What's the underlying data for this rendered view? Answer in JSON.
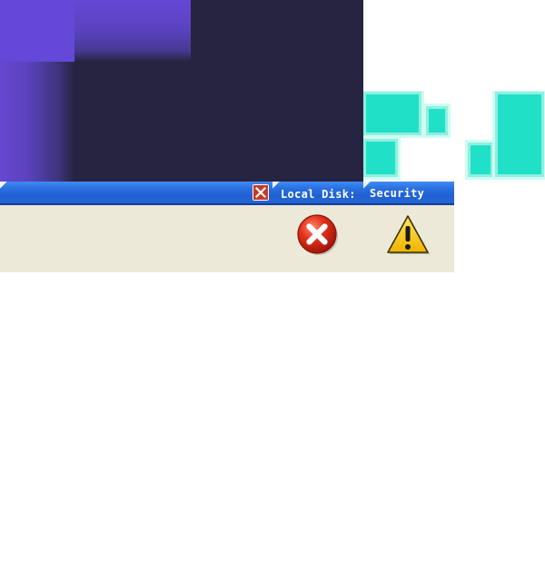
{
  "desktop": {
    "colors": {
      "purple_accent": "#6448d8",
      "dark_background": "#272441",
      "cyan_accent": "#20e0c8"
    }
  },
  "window": {
    "title_bar_color": "#2566d8",
    "body_color": "#ece9d8",
    "close_button": {
      "icon": "close-icon"
    },
    "tabs": [
      {
        "label": "Local Disk:"
      },
      {
        "label": "Security"
      }
    ],
    "icons": [
      {
        "name": "error-icon",
        "color": "#d62a14"
      },
      {
        "name": "warning-icon",
        "color": "#f4c20d"
      }
    ]
  }
}
